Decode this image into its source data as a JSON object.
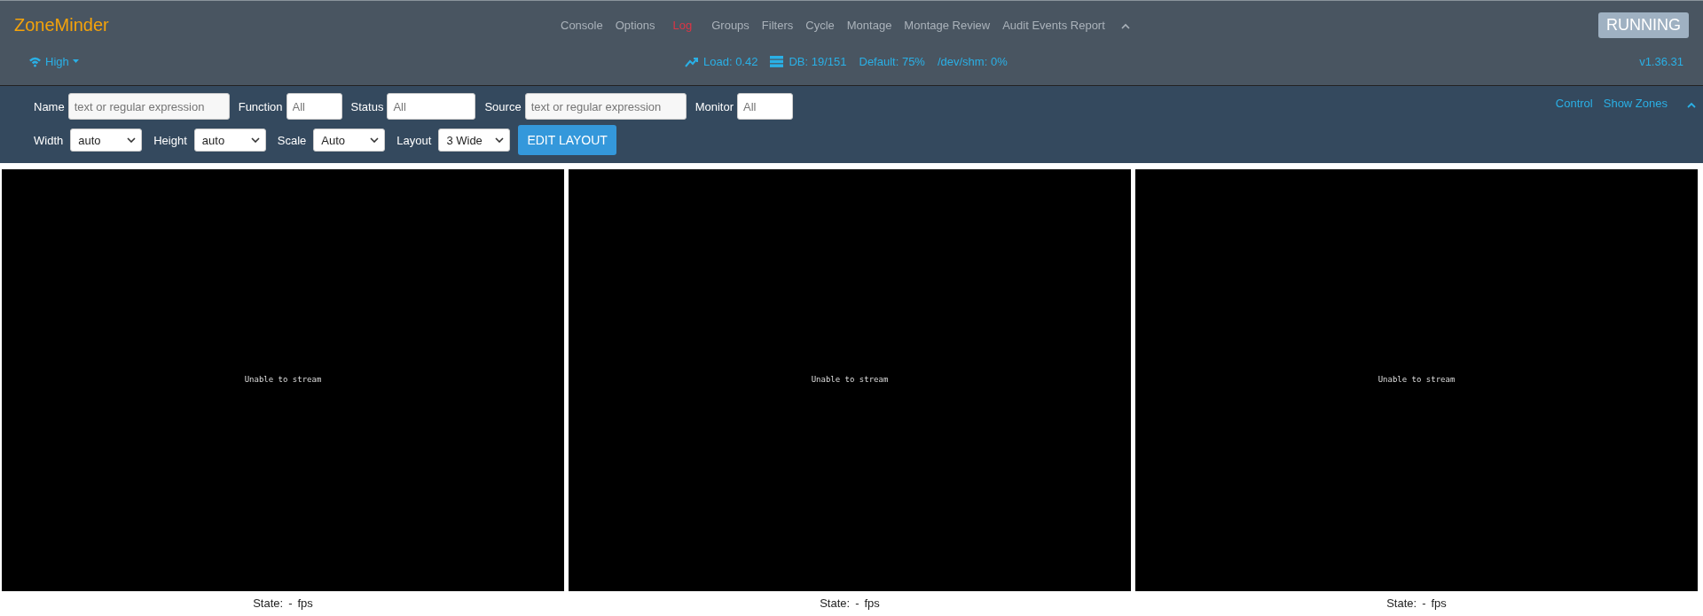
{
  "brand": "ZoneMinder",
  "nav": [
    {
      "label": "Console",
      "alert": false
    },
    {
      "label": "Options",
      "alert": false
    },
    {
      "label": "Log",
      "alert": true
    },
    {
      "label": "Groups",
      "alert": false
    },
    {
      "label": "Filters",
      "alert": false
    },
    {
      "label": "Cycle",
      "alert": false
    },
    {
      "label": "Montage",
      "alert": false
    },
    {
      "label": "Montage Review",
      "alert": false
    },
    {
      "label": "Audit Events Report",
      "alert": false
    }
  ],
  "run_state": "RUNNING",
  "bandwidth": "High",
  "stats": [
    {
      "kind": "load",
      "text": "Load: 0.42"
    },
    {
      "kind": "db",
      "text": "DB: 19/151"
    },
    {
      "kind": "plain",
      "text": "Default: 75%"
    },
    {
      "kind": "plain",
      "text": "/dev/shm: 0%"
    }
  ],
  "version": "v1.36.31",
  "filters": [
    {
      "label": "Name",
      "placeholder": "text or regular expression"
    },
    {
      "label": "Function",
      "placeholder": "All"
    },
    {
      "label": "Status",
      "placeholder": "All"
    },
    {
      "label": "Source",
      "placeholder": "text or regular expression"
    },
    {
      "label": "Monitor",
      "placeholder": "All"
    }
  ],
  "selects": [
    {
      "label": "Width",
      "value": "auto"
    },
    {
      "label": "Height",
      "value": "auto"
    },
    {
      "label": "Scale",
      "value": "Auto"
    },
    {
      "label": "Layout",
      "value": "3 Wide"
    }
  ],
  "edit_layout_button": "EDIT LAYOUT",
  "right_links": [
    "Control",
    "Show Zones"
  ],
  "monitors": [
    {
      "message": "Unable to stream",
      "state_label": "State:",
      "state": "-",
      "fps": "fps"
    },
    {
      "message": "Unable to stream",
      "state_label": "State:",
      "state": "-",
      "fps": "fps"
    },
    {
      "message": "Unable to stream",
      "state_label": "State:",
      "state": "-",
      "fps": "fps"
    }
  ]
}
